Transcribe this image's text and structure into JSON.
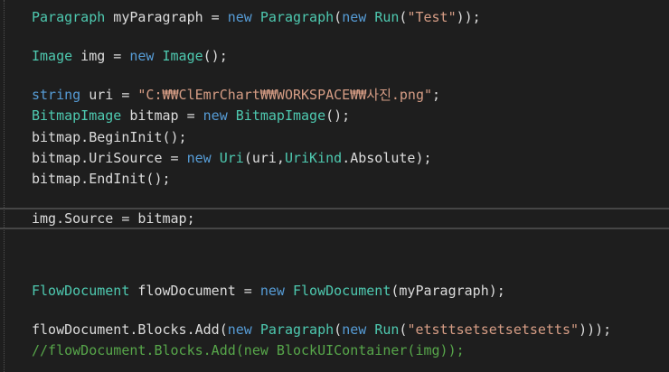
{
  "editor": {
    "colors": {
      "background": "#1e1e1e",
      "type": "#4ec9b0",
      "keyword": "#569cd6",
      "string": "#d69d85",
      "identifier": "#dcdcdc",
      "comment": "#57a64a"
    },
    "lines": [
      {
        "tokens": [
          {
            "k": "type",
            "t": "Paragraph"
          },
          {
            "k": "id",
            "t": " myParagraph = "
          },
          {
            "k": "kw",
            "t": "new"
          },
          {
            "k": "id",
            "t": " "
          },
          {
            "k": "type",
            "t": "Paragraph"
          },
          {
            "k": "id",
            "t": "("
          },
          {
            "k": "kw",
            "t": "new"
          },
          {
            "k": "id",
            "t": " "
          },
          {
            "k": "type",
            "t": "Run"
          },
          {
            "k": "id",
            "t": "("
          },
          {
            "k": "str",
            "t": "\"Test\""
          },
          {
            "k": "id",
            "t": "));"
          }
        ]
      },
      {
        "tokens": [
          {
            "k": "type",
            "t": "Image"
          },
          {
            "k": "id",
            "t": " img = "
          },
          {
            "k": "kw",
            "t": "new"
          },
          {
            "k": "id",
            "t": " "
          },
          {
            "k": "type",
            "t": "Image"
          },
          {
            "k": "id",
            "t": "();"
          }
        ]
      },
      {
        "tokens": [
          {
            "k": "kw",
            "t": "string"
          },
          {
            "k": "id",
            "t": " uri = "
          },
          {
            "k": "str",
            "t": "\"C:₩₩ClEmrChart₩₩WORKSPACE₩₩사진.png\""
          },
          {
            "k": "id",
            "t": ";"
          }
        ]
      },
      {
        "tokens": [
          {
            "k": "type",
            "t": "BitmapImage"
          },
          {
            "k": "id",
            "t": " bitmap = "
          },
          {
            "k": "kw",
            "t": "new"
          },
          {
            "k": "id",
            "t": " "
          },
          {
            "k": "type",
            "t": "BitmapImage"
          },
          {
            "k": "id",
            "t": "();"
          }
        ]
      },
      {
        "tokens": [
          {
            "k": "id",
            "t": "bitmap.BeginInit();"
          }
        ]
      },
      {
        "tokens": [
          {
            "k": "id",
            "t": "bitmap.UriSource = "
          },
          {
            "k": "kw",
            "t": "new"
          },
          {
            "k": "id",
            "t": " "
          },
          {
            "k": "type",
            "t": "Uri"
          },
          {
            "k": "id",
            "t": "(uri,"
          },
          {
            "k": "type",
            "t": "UriKind"
          },
          {
            "k": "id",
            "t": ".Absolute);"
          }
        ]
      },
      {
        "tokens": [
          {
            "k": "id",
            "t": "bitmap.EndInit();"
          }
        ]
      },
      {
        "tokens": [
          {
            "k": "id",
            "t": "img.Source = bitmap;"
          }
        ]
      },
      {
        "tokens": [
          {
            "k": "type",
            "t": "FlowDocument"
          },
          {
            "k": "id",
            "t": " flowDocument = "
          },
          {
            "k": "kw",
            "t": "new"
          },
          {
            "k": "id",
            "t": " "
          },
          {
            "k": "type",
            "t": "FlowDocument"
          },
          {
            "k": "id",
            "t": "(myParagraph);"
          }
        ]
      },
      {
        "tokens": [
          {
            "k": "id",
            "t": "flowDocument.Blocks.Add("
          },
          {
            "k": "kw",
            "t": "new"
          },
          {
            "k": "id",
            "t": " "
          },
          {
            "k": "type",
            "t": "Paragraph"
          },
          {
            "k": "id",
            "t": "("
          },
          {
            "k": "kw",
            "t": "new"
          },
          {
            "k": "id",
            "t": " "
          },
          {
            "k": "type",
            "t": "Run"
          },
          {
            "k": "id",
            "t": "("
          },
          {
            "k": "str",
            "t": "\"etsttsetsetsetsetts\""
          },
          {
            "k": "id",
            "t": ")));"
          }
        ]
      },
      {
        "tokens": [
          {
            "k": "comment",
            "t": "//flowDocument.Blocks.Add(new BlockUIContainer(img));"
          }
        ]
      }
    ]
  }
}
